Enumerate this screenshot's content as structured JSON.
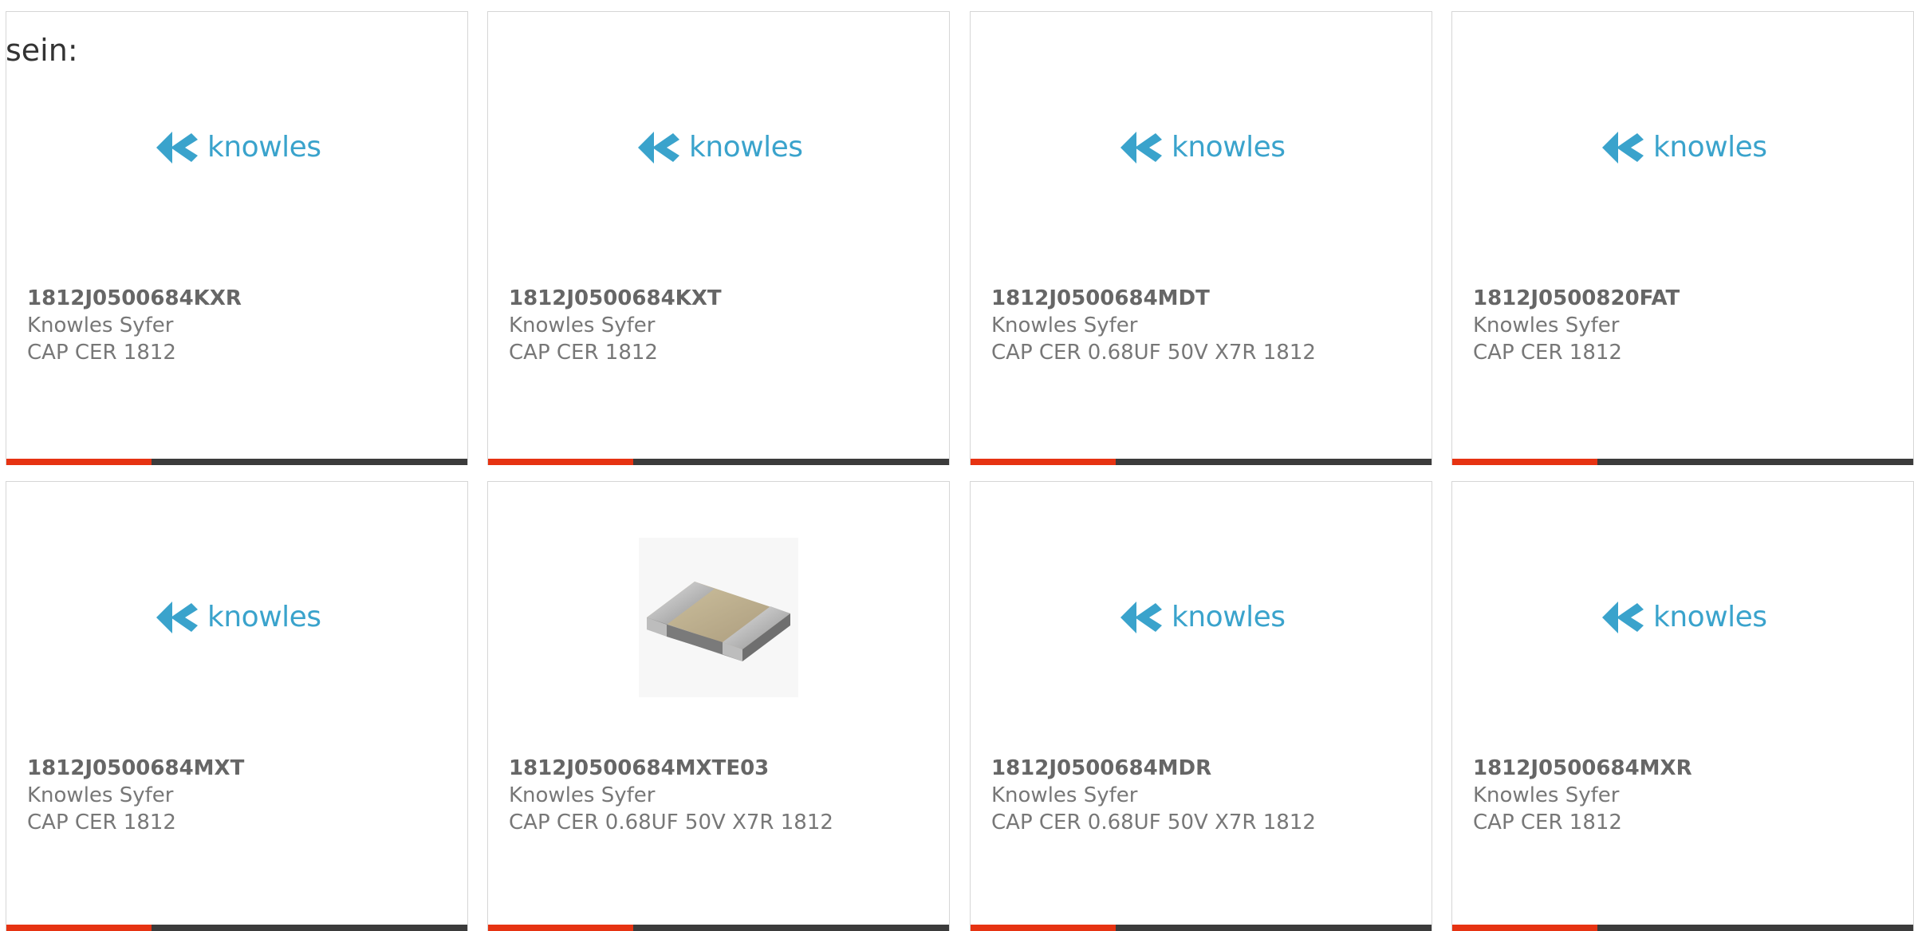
{
  "intro_text": "sein:",
  "colors": {
    "brand_logo": "#3aa3cc",
    "bar_accent": "#e63312",
    "bar_base": "#3b3b3b"
  },
  "cards": [
    {
      "part_number": "1812J0500684KXR",
      "manufacturer": "Knowles Syfer",
      "description": "CAP CER 1812",
      "image": "knowles-logo",
      "logo_text": "knowles"
    },
    {
      "part_number": "1812J0500684KXT",
      "manufacturer": "Knowles Syfer",
      "description": "CAP CER 1812",
      "image": "knowles-logo",
      "logo_text": "knowles"
    },
    {
      "part_number": "1812J0500684MDT",
      "manufacturer": "Knowles Syfer",
      "description": "CAP CER 0.68UF 50V X7R 1812",
      "image": "knowles-logo",
      "logo_text": "knowles"
    },
    {
      "part_number": "1812J0500820FAT",
      "manufacturer": "Knowles Syfer",
      "description": "CAP CER 1812",
      "image": "knowles-logo",
      "logo_text": "knowles"
    },
    {
      "part_number": "1812J0500684MXT",
      "manufacturer": "Knowles Syfer",
      "description": "CAP CER 1812",
      "image": "knowles-logo",
      "logo_text": "knowles"
    },
    {
      "part_number": "1812J0500684MXTE03",
      "manufacturer": "Knowles Syfer",
      "description": "CAP CER 0.68UF 50V X7R 1812",
      "image": "smd-capacitor-photo"
    },
    {
      "part_number": "1812J0500684MDR",
      "manufacturer": "Knowles Syfer",
      "description": "CAP CER 0.68UF 50V X7R 1812",
      "image": "knowles-logo",
      "logo_text": "knowles"
    },
    {
      "part_number": "1812J0500684MXR",
      "manufacturer": "Knowles Syfer",
      "description": "CAP CER 1812",
      "image": "knowles-logo",
      "logo_text": "knowles"
    }
  ]
}
